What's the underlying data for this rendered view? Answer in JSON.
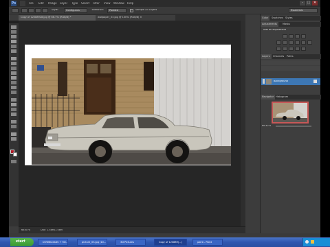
{
  "app": {
    "logo": "Ps",
    "menu": [
      "File",
      "Edit",
      "Image",
      "Layer",
      "Type",
      "Select",
      "Filter",
      "View",
      "Window",
      "Help"
    ],
    "workspace": "Essentials",
    "window_controls": [
      "–",
      "□",
      "✕"
    ]
  },
  "options": {
    "style_label": "Style:",
    "style_value": "Contiguous",
    "tolerance_label": "Tolerance:",
    "tolerance_value": "Padded",
    "checkbox_label": "Sample All Layers"
  },
  "doc_tabs": [
    {
      "label": "Copy of 12088928.jpg @ 66.7% (RGB/8) *"
    },
    {
      "label": "wallpaper_03.jpg @ 100% (RGB/8) ✕"
    }
  ],
  "status": {
    "zoom": "66.67%",
    "doc_info": "Doc: 1.58M/1.58M"
  },
  "panels": {
    "color_tabs": [
      "Color",
      "Swatches",
      "Styles"
    ],
    "adjust_tabs": [
      "Adjustments",
      "Masks"
    ],
    "adjust_title": "Add an adjustment",
    "layers_tabs": [
      "Layers",
      "Channels",
      "Paths"
    ],
    "layer_name": "Background",
    "navigator_tabs": [
      "Navigator",
      "Histogram"
    ],
    "nav_zoom": "66.67%"
  },
  "taskbar": {
    "start_label": "start",
    "items": [
      {
        "label": "DOWNLOADS + file..."
      },
      {
        "label": "picture_03.jpg (10..."
      },
      {
        "label": "3D Pictures"
      },
      {
        "label": "Copy of 120889(...)"
      },
      {
        "label": "paint - Paint"
      }
    ],
    "active_index": 3
  }
}
